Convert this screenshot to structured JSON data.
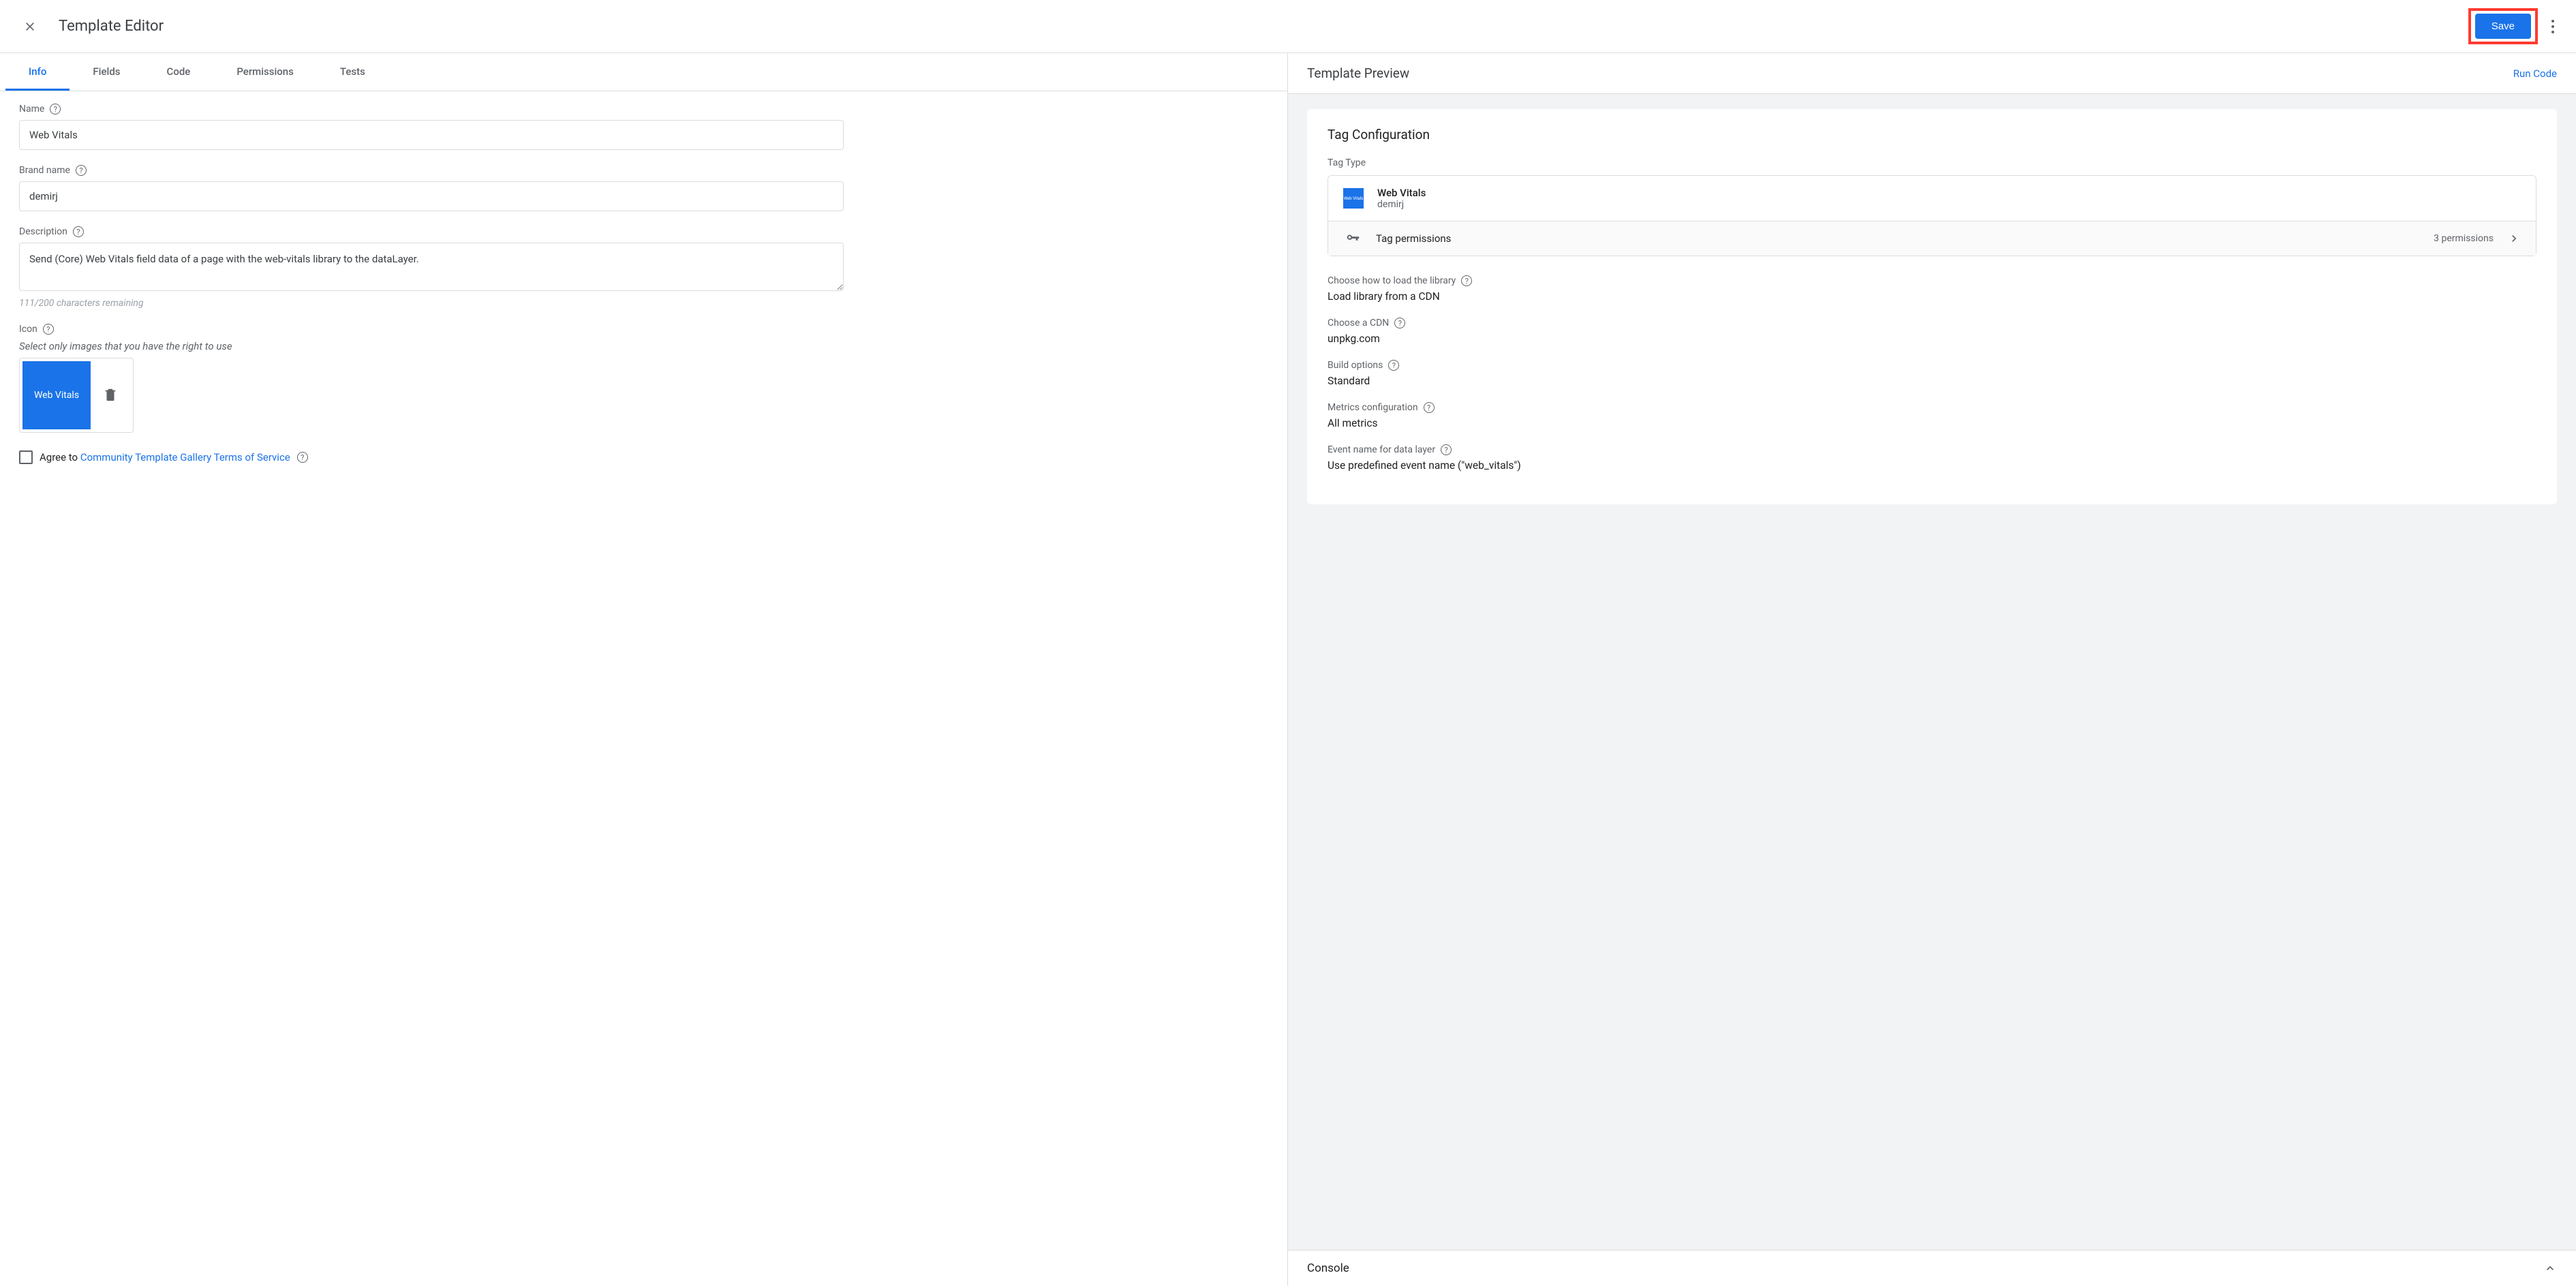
{
  "header": {
    "title": "Template Editor",
    "save_label": "Save"
  },
  "tabs": [
    "Info",
    "Fields",
    "Code",
    "Permissions",
    "Tests"
  ],
  "active_tab_index": 0,
  "form": {
    "name_label": "Name",
    "name_value": "Web Vitals",
    "brand_label": "Brand name",
    "brand_value": "demirj",
    "description_label": "Description",
    "description_value": "Send (Core) Web Vitals field data of a page with the web-vitals library to the dataLayer.",
    "char_hint": "111/200 characters remaining",
    "icon_label": "Icon",
    "icon_hint": "Select only images that you have the right to use",
    "icon_chip_text": "Web Vitals",
    "agree_prefix": "Agree to ",
    "agree_link": "Community Template Gallery Terms of Service"
  },
  "preview": {
    "title": "Template Preview",
    "run_label": "Run Code",
    "card_title": "Tag Configuration",
    "tag_type_label": "Tag Type",
    "tag_type_name": "Web Vitals",
    "tag_type_brand": "demirj",
    "tag_type_chip": "Web Vitals",
    "perm_label": "Tag permissions",
    "perm_count": "3 permissions",
    "fields": [
      {
        "label": "Choose how to load the library",
        "value": "Load library from a CDN",
        "help": true
      },
      {
        "label": "Choose a CDN",
        "value": "unpkg.com",
        "help": true
      },
      {
        "label": "Build options",
        "value": "Standard",
        "help": true
      },
      {
        "label": "Metrics configuration",
        "value": "All metrics",
        "help": true
      },
      {
        "label": "Event name for data layer",
        "value": "Use predefined event name (\"web_vitals\")",
        "help": true
      }
    ],
    "console_label": "Console"
  }
}
